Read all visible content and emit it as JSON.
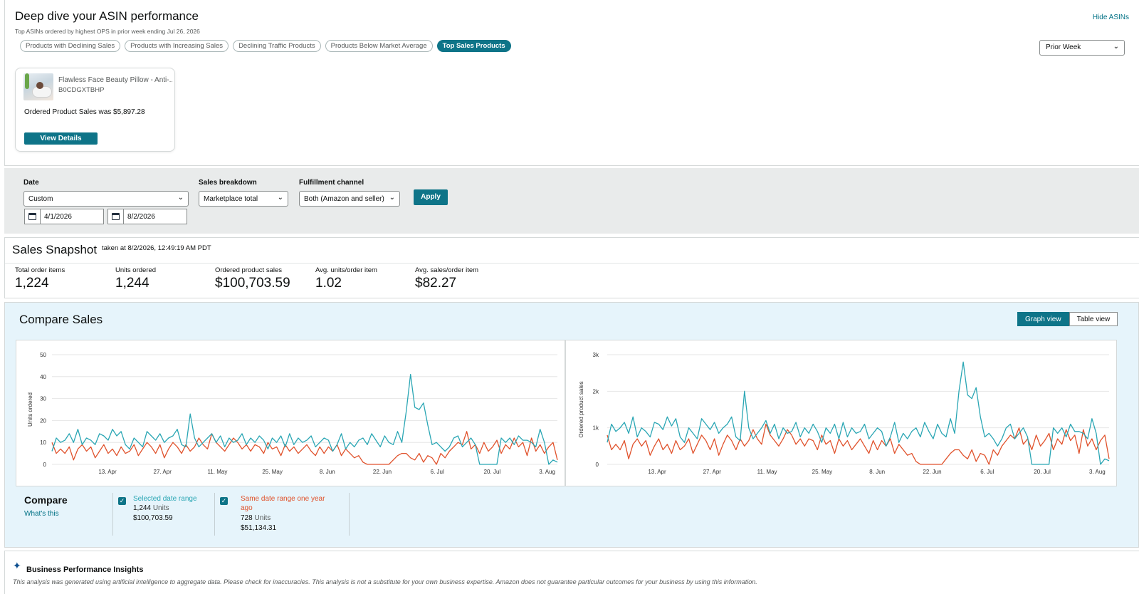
{
  "asin_section": {
    "title": "Deep dive your ASIN performance",
    "subtitle": "Top ASINs ordered by highest OPS in prior week ending Jul 26, 2026",
    "hide_link": "Hide ASINs",
    "chips": [
      {
        "label": "Products with Declining Sales",
        "active": false
      },
      {
        "label": "Products with Increasing Sales",
        "active": false
      },
      {
        "label": "Declining Traffic Products",
        "active": false
      },
      {
        "label": "Products Below Market Average",
        "active": false
      },
      {
        "label": "Top Sales Products",
        "active": true
      }
    ],
    "period": "Prior Week",
    "card": {
      "name": "Flawless Face Beauty Pillow - Anti-...",
      "asin": "B0CDGXTBHP",
      "sales_text": "Ordered Product Sales was $5,897.28",
      "button": "View Details"
    }
  },
  "filters": {
    "date_label": "Date",
    "date_value": "Custom",
    "start_date": "4/1/2026",
    "end_date": "8/2/2026",
    "breakdown_label": "Sales breakdown",
    "breakdown_value": "Marketplace total",
    "channel_label": "Fulfillment channel",
    "channel_value": "Both (Amazon and seller)",
    "apply": "Apply"
  },
  "snapshot": {
    "title": "Sales Snapshot",
    "taken_at": "taken at 8/2/2026, 12:49:19 AM PDT",
    "metrics": [
      {
        "label": "Total order items",
        "value": "1,224"
      },
      {
        "label": "Units ordered",
        "value": "1,244"
      },
      {
        "label": "Ordered product sales",
        "value": "$100,703.59"
      },
      {
        "label": "Avg. units/order item",
        "value": "1.02"
      },
      {
        "label": "Avg. sales/order item",
        "value": "$82.27"
      }
    ]
  },
  "compare": {
    "title": "Compare Sales",
    "graph_view": "Graph view",
    "table_view": "Table view",
    "legend_title": "Compare",
    "whats_this": "What's this",
    "selected": {
      "name": "Selected date range",
      "units": "1,244",
      "units_word": "Units",
      "sales": "$100,703.59"
    },
    "prior": {
      "name_line1": "Same date range one year",
      "name_line2": "ago",
      "units": "728",
      "units_word": "Units",
      "sales": "$51,134.31"
    }
  },
  "colors": {
    "current": "#2aa6b4",
    "prior": "#e0522c",
    "accent": "#0e7488"
  },
  "chart_data": [
    {
      "type": "line",
      "ylabel": "Units ordered",
      "ylim": [
        0,
        50
      ],
      "yticks": [
        "0",
        "10",
        "20",
        "30",
        "40",
        "50"
      ],
      "xtick_labels": [
        "13. Apr",
        "27. Apr",
        "11. May",
        "25. May",
        "8. Jun",
        "22. Jun",
        "6. Jul",
        "20. Jul",
        "3. Aug"
      ],
      "x_start": "2026-04-01",
      "series": [
        {
          "name": "Selected date range",
          "values": [
            6,
            12,
            10,
            11,
            14,
            10,
            16,
            9,
            12,
            11,
            9,
            14,
            13,
            11,
            16,
            13,
            15,
            9,
            7,
            12,
            10,
            8,
            15,
            13,
            11,
            14,
            10,
            12,
            13,
            16,
            9,
            8,
            23,
            12,
            8,
            10,
            12,
            14,
            10,
            13,
            8,
            12,
            10,
            11,
            14,
            9,
            12,
            10,
            13,
            11,
            7,
            12,
            10,
            13,
            8,
            14,
            9,
            12,
            10,
            11,
            13,
            8,
            10,
            12,
            11,
            6,
            9,
            14,
            7,
            10,
            8,
            11,
            12,
            9,
            14,
            11,
            8,
            13,
            10,
            9,
            15,
            10,
            24,
            41,
            26,
            25,
            28,
            18,
            9,
            10,
            8,
            6,
            8,
            12,
            13,
            8,
            10,
            12,
            9,
            0,
            0,
            0,
            0,
            0,
            12,
            10,
            12,
            9,
            13,
            11,
            11,
            10,
            8,
            16,
            10,
            0,
            2,
            1
          ]
        },
        {
          "name": "Same date range one year ago",
          "values": [
            10,
            5,
            7,
            5,
            8,
            2,
            7,
            9,
            6,
            8,
            3,
            6,
            9,
            5,
            7,
            4,
            8,
            5,
            6,
            9,
            4,
            7,
            10,
            8,
            5,
            9,
            3,
            7,
            10,
            8,
            5,
            9,
            6,
            8,
            12,
            9,
            7,
            14,
            10,
            8,
            6,
            9,
            12,
            10,
            7,
            9,
            6,
            9,
            8,
            5,
            10,
            7,
            8,
            4,
            9,
            6,
            8,
            5,
            7,
            9,
            6,
            4,
            8,
            5,
            8,
            6,
            9,
            4,
            7,
            5,
            3,
            4,
            1,
            0,
            0,
            0,
            0,
            0,
            0,
            2,
            4,
            5,
            5,
            3,
            2,
            5,
            1,
            4,
            3,
            0,
            5,
            3,
            6,
            8,
            10,
            9,
            15,
            7,
            9,
            5,
            10,
            6,
            8,
            11,
            5,
            9,
            7,
            12,
            8,
            10,
            4,
            12,
            6,
            9,
            5,
            8,
            10,
            2
          ]
        }
      ]
    },
    {
      "type": "line",
      "ylabel": "Ordered product sales",
      "ylim": [
        0,
        3000
      ],
      "yticks": [
        "0",
        "1k",
        "2k",
        "3k"
      ],
      "xtick_labels": [
        "13. Apr",
        "27. Apr",
        "11. May",
        "25. May",
        "8. Jun",
        "22. Jun",
        "6. Jul",
        "20. Jul",
        "3. Aug"
      ],
      "x_start": "2026-04-01",
      "series": [
        {
          "name": "Selected date range",
          "values": [
            600,
            1100,
            900,
            1000,
            1150,
            850,
            1300,
            750,
            1000,
            900,
            750,
            1150,
            1100,
            950,
            1300,
            1050,
            1250,
            750,
            600,
            1000,
            850,
            700,
            1250,
            1100,
            950,
            1150,
            850,
            1000,
            1100,
            1300,
            750,
            650,
            2000,
            1000,
            700,
            850,
            1000,
            1200,
            850,
            1100,
            700,
            1000,
            850,
            900,
            1150,
            750,
            1000,
            850,
            1100,
            900,
            600,
            1000,
            850,
            1100,
            700,
            1150,
            750,
            1000,
            850,
            900,
            1100,
            700,
            850,
            1000,
            900,
            500,
            750,
            1150,
            600,
            850,
            700,
            900,
            1000,
            750,
            1150,
            900,
            700,
            1100,
            850,
            750,
            1250,
            850,
            2000,
            2800,
            1900,
            1800,
            2100,
            1300,
            750,
            850,
            700,
            500,
            700,
            1000,
            1100,
            700,
            850,
            1000,
            750,
            0,
            0,
            0,
            0,
            0,
            1000,
            850,
            1000,
            750,
            1100,
            900,
            900,
            850,
            700,
            1250,
            850,
            0,
            150,
            100
          ]
        },
        {
          "name": "Same date range one year ago",
          "values": [
            800,
            400,
            550,
            400,
            650,
            150,
            550,
            700,
            500,
            650,
            250,
            500,
            700,
            400,
            550,
            300,
            650,
            400,
            500,
            700,
            300,
            550,
            800,
            650,
            400,
            700,
            250,
            550,
            800,
            650,
            400,
            700,
            500,
            650,
            950,
            700,
            550,
            1100,
            800,
            650,
            500,
            700,
            950,
            800,
            550,
            700,
            500,
            700,
            650,
            400,
            800,
            550,
            650,
            300,
            700,
            500,
            650,
            400,
            550,
            700,
            500,
            300,
            650,
            400,
            650,
            500,
            700,
            300,
            550,
            400,
            250,
            300,
            80,
            0,
            0,
            0,
            0,
            0,
            0,
            150,
            300,
            400,
            400,
            250,
            150,
            400,
            80,
            300,
            250,
            0,
            400,
            250,
            500,
            650,
            800,
            700,
            1000,
            550,
            700,
            400,
            800,
            500,
            650,
            850,
            400,
            700,
            550,
            950,
            650,
            800,
            300,
            950,
            500,
            700,
            400,
            650,
            800,
            150
          ]
        }
      ]
    }
  ],
  "insights": {
    "title": "Business Performance Insights",
    "disclaimer": "This analysis was generated using artificial intelligence to aggregate data. Please check for inaccuracies. This analysis is not a substitute for your own business expertise. Amazon does not guarantee particular outcomes for your business by using this information."
  }
}
